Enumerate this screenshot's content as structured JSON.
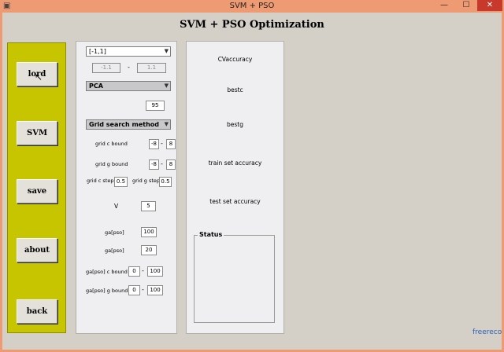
{
  "window": {
    "title": "SVM + PSO",
    "minimize": "—",
    "maximize": "☐",
    "close": "✕"
  },
  "app_title": "SVM + PSO Optimization",
  "sidebar": {
    "buttons": [
      "lord",
      "SVM",
      "save",
      "about",
      "back"
    ]
  },
  "params": {
    "range_select": "[-1,1]",
    "range_min": "-1.1",
    "range_max": "1.1",
    "reduction_select": "PCA",
    "reduction_value": "95",
    "method_select": "Grid search method",
    "grid_c_label": "grid c bound",
    "grid_c_min": "-8",
    "grid_c_max": "8",
    "grid_g_label": "grid g bound",
    "grid_g_min": "-8",
    "grid_g_max": "8",
    "grid_c_step_label": "grid c step",
    "grid_c_step": "0.5",
    "grid_g_step_label": "grid g step",
    "grid_g_step": "0.5",
    "v_label": "V",
    "v_value": "5",
    "ga_pso_1_label": "ga[pso]",
    "ga_pso_1_value": "100",
    "ga_pso_2_label": "ga[pso]",
    "ga_pso_2_value": "20",
    "ga_c_bound_label": "ga[pso] c bound",
    "ga_c_min": "0",
    "ga_c_max": "100",
    "ga_g_bound_label": "ga[pso] g bound",
    "ga_g_min": "0",
    "ga_g_max": "100",
    "dash": "-"
  },
  "results": {
    "cv_accuracy": "CVaccuracy",
    "bestc": "bestc",
    "bestg": "bestg",
    "train_acc": "train set accuracy",
    "test_acc": "test set accuracy",
    "status_title": "Status"
  },
  "watermark": "freereco",
  "colors": {
    "sidebar": "#c7c400",
    "titlebar": "#ee9a73",
    "background": "#d4d0c8"
  }
}
